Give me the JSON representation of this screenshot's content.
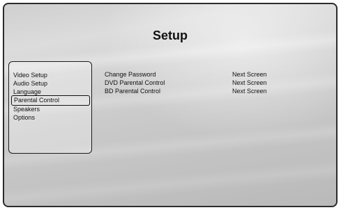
{
  "title": "Setup",
  "sidebar": {
    "items": [
      {
        "label": "Video Setup"
      },
      {
        "label": "Audio Setup"
      },
      {
        "label": "Language"
      },
      {
        "label": "Parental Control",
        "selected": true
      },
      {
        "label": "Speakers"
      },
      {
        "label": "Options"
      }
    ]
  },
  "content": {
    "rows": [
      {
        "label": "Change Password",
        "value": "Next Screen"
      },
      {
        "label": "DVD Parental Control",
        "value": "Next Screen"
      },
      {
        "label": "BD Parental Control",
        "value": "Next Screen"
      }
    ]
  }
}
